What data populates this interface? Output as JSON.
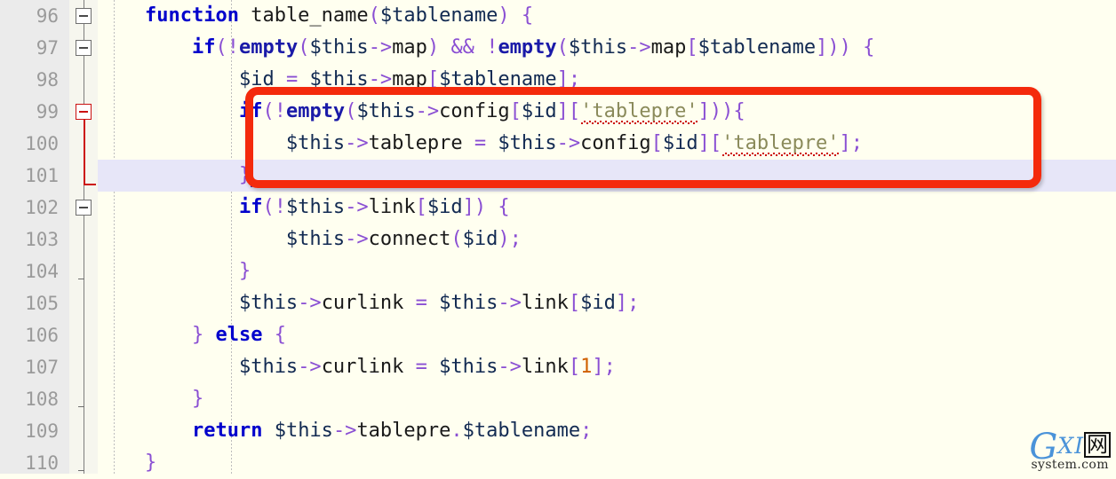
{
  "editor": {
    "background_color": "#fffff0",
    "gutter_color": "#ebebeb",
    "line_number_color": "#9a9a9a",
    "current_line_highlight_color": "#e7e6f8",
    "annotation_color": "#f42a0c",
    "first_line": 96,
    "last_line": 110,
    "current_line": 101
  },
  "line_numbers": [
    "96",
    "97",
    "98",
    "99",
    "100",
    "101",
    "102",
    "103",
    "104",
    "105",
    "106",
    "107",
    "108",
    "109",
    "110"
  ],
  "fold_markers": [
    {
      "line": "96",
      "type": "minus-box",
      "color": "#6e6e6e"
    },
    {
      "line": "97",
      "type": "minus-box",
      "color": "#6e6e6e"
    },
    {
      "line": "99",
      "type": "minus-box",
      "color": "#cc1111"
    },
    {
      "line": "101",
      "type": "fold-end",
      "color": "#cc1111"
    },
    {
      "line": "102",
      "type": "minus-box",
      "color": "#6e6e6e"
    },
    {
      "line": "104",
      "type": "tick",
      "color": "#6e6e6e"
    },
    {
      "line": "108",
      "type": "tick",
      "color": "#6e6e6e"
    },
    {
      "line": "110",
      "type": "tick",
      "color": "#6e6e6e"
    }
  ],
  "code_lines": [
    {
      "number": "96",
      "plain": "    function table_name($tablename) {",
      "tokens": [
        {
          "t": "    ",
          "c": "plain"
        },
        {
          "t": "function",
          "c": "kw"
        },
        {
          "t": " ",
          "c": "plain"
        },
        {
          "t": "table_name",
          "c": "plain"
        },
        {
          "t": "(",
          "c": "op"
        },
        {
          "t": "$tablename",
          "c": "var"
        },
        {
          "t": ")",
          "c": "op"
        },
        {
          "t": " ",
          "c": "plain"
        },
        {
          "t": "{",
          "c": "brc"
        }
      ]
    },
    {
      "number": "97",
      "plain": "        if(!empty($this->map) && !empty($this->map[$tablename])) {",
      "tokens": [
        {
          "t": "        ",
          "c": "plain"
        },
        {
          "t": "if",
          "c": "kw"
        },
        {
          "t": "(",
          "c": "op"
        },
        {
          "t": "!",
          "c": "op"
        },
        {
          "t": "empty",
          "c": "fn"
        },
        {
          "t": "(",
          "c": "op"
        },
        {
          "t": "$this",
          "c": "var"
        },
        {
          "t": "->",
          "c": "arrow"
        },
        {
          "t": "map",
          "c": "plain"
        },
        {
          "t": ")",
          "c": "op"
        },
        {
          "t": " ",
          "c": "plain"
        },
        {
          "t": "&&",
          "c": "op"
        },
        {
          "t": " ",
          "c": "plain"
        },
        {
          "t": "!",
          "c": "op"
        },
        {
          "t": "empty",
          "c": "fn"
        },
        {
          "t": "(",
          "c": "op"
        },
        {
          "t": "$this",
          "c": "var"
        },
        {
          "t": "->",
          "c": "arrow"
        },
        {
          "t": "map",
          "c": "plain"
        },
        {
          "t": "[",
          "c": "op"
        },
        {
          "t": "$tablename",
          "c": "var"
        },
        {
          "t": "]",
          "c": "op"
        },
        {
          "t": "))",
          "c": "op"
        },
        {
          "t": " ",
          "c": "plain"
        },
        {
          "t": "{",
          "c": "brc"
        }
      ]
    },
    {
      "number": "98",
      "plain": "            $id = $this->map[$tablename];",
      "tokens": [
        {
          "t": "            ",
          "c": "plain"
        },
        {
          "t": "$id",
          "c": "var"
        },
        {
          "t": " ",
          "c": "plain"
        },
        {
          "t": "=",
          "c": "op"
        },
        {
          "t": " ",
          "c": "plain"
        },
        {
          "t": "$this",
          "c": "var"
        },
        {
          "t": "->",
          "c": "arrow"
        },
        {
          "t": "map",
          "c": "plain"
        },
        {
          "t": "[",
          "c": "op"
        },
        {
          "t": "$tablename",
          "c": "var"
        },
        {
          "t": "]",
          "c": "op"
        },
        {
          "t": ";",
          "c": "op"
        }
      ]
    },
    {
      "number": "99",
      "plain": "            if(!empty($this->config[$id]['tablepre'])){",
      "tokens": [
        {
          "t": "            ",
          "c": "plain"
        },
        {
          "t": "if",
          "c": "kw"
        },
        {
          "t": "(",
          "c": "op"
        },
        {
          "t": "!",
          "c": "op"
        },
        {
          "t": "empty",
          "c": "fn"
        },
        {
          "t": "(",
          "c": "op"
        },
        {
          "t": "$this",
          "c": "var"
        },
        {
          "t": "->",
          "c": "arrow"
        },
        {
          "t": "config",
          "c": "plain"
        },
        {
          "t": "[",
          "c": "op"
        },
        {
          "t": "$id",
          "c": "var"
        },
        {
          "t": "]",
          "c": "op"
        },
        {
          "t": "[",
          "c": "op"
        },
        {
          "t": "'tablepre'",
          "c": "str squig"
        },
        {
          "t": "]",
          "c": "op"
        },
        {
          "t": "))",
          "c": "op"
        },
        {
          "t": "{",
          "c": "brc"
        }
      ]
    },
    {
      "number": "100",
      "plain": "                $this->tablepre = $this->config[$id]['tablepre'];",
      "tokens": [
        {
          "t": "                ",
          "c": "plain"
        },
        {
          "t": "$this",
          "c": "var"
        },
        {
          "t": "->",
          "c": "arrow"
        },
        {
          "t": "tablepre",
          "c": "plain"
        },
        {
          "t": " ",
          "c": "plain"
        },
        {
          "t": "=",
          "c": "op"
        },
        {
          "t": " ",
          "c": "plain"
        },
        {
          "t": "$this",
          "c": "var"
        },
        {
          "t": "->",
          "c": "arrow"
        },
        {
          "t": "config",
          "c": "plain"
        },
        {
          "t": "[",
          "c": "op"
        },
        {
          "t": "$id",
          "c": "var"
        },
        {
          "t": "]",
          "c": "op"
        },
        {
          "t": "[",
          "c": "op"
        },
        {
          "t": "'tablepre'",
          "c": "str squig"
        },
        {
          "t": "]",
          "c": "op"
        },
        {
          "t": ";",
          "c": "op"
        }
      ]
    },
    {
      "number": "101",
      "plain": "            }",
      "tokens": [
        {
          "t": "            ",
          "c": "plain"
        },
        {
          "t": "}",
          "c": "brc"
        }
      ]
    },
    {
      "number": "102",
      "plain": "            if(!$this->link[$id]) {",
      "tokens": [
        {
          "t": "            ",
          "c": "plain"
        },
        {
          "t": "if",
          "c": "kw"
        },
        {
          "t": "(",
          "c": "op"
        },
        {
          "t": "!",
          "c": "op"
        },
        {
          "t": "$this",
          "c": "var"
        },
        {
          "t": "->",
          "c": "arrow"
        },
        {
          "t": "link",
          "c": "plain"
        },
        {
          "t": "[",
          "c": "op"
        },
        {
          "t": "$id",
          "c": "var"
        },
        {
          "t": "]",
          "c": "op"
        },
        {
          "t": ")",
          "c": "op"
        },
        {
          "t": " ",
          "c": "plain"
        },
        {
          "t": "{",
          "c": "brc"
        }
      ]
    },
    {
      "number": "103",
      "plain": "                $this->connect($id);",
      "tokens": [
        {
          "t": "                ",
          "c": "plain"
        },
        {
          "t": "$this",
          "c": "var"
        },
        {
          "t": "->",
          "c": "arrow"
        },
        {
          "t": "connect",
          "c": "plain"
        },
        {
          "t": "(",
          "c": "op"
        },
        {
          "t": "$id",
          "c": "var"
        },
        {
          "t": ")",
          "c": "op"
        },
        {
          "t": ";",
          "c": "op"
        }
      ]
    },
    {
      "number": "104",
      "plain": "            }",
      "tokens": [
        {
          "t": "            ",
          "c": "plain"
        },
        {
          "t": "}",
          "c": "brc"
        }
      ]
    },
    {
      "number": "105",
      "plain": "            $this->curlink = $this->link[$id];",
      "tokens": [
        {
          "t": "            ",
          "c": "plain"
        },
        {
          "t": "$this",
          "c": "var"
        },
        {
          "t": "->",
          "c": "arrow"
        },
        {
          "t": "curlink",
          "c": "plain"
        },
        {
          "t": " ",
          "c": "plain"
        },
        {
          "t": "=",
          "c": "op"
        },
        {
          "t": " ",
          "c": "plain"
        },
        {
          "t": "$this",
          "c": "var"
        },
        {
          "t": "->",
          "c": "arrow"
        },
        {
          "t": "link",
          "c": "plain"
        },
        {
          "t": "[",
          "c": "op"
        },
        {
          "t": "$id",
          "c": "var"
        },
        {
          "t": "]",
          "c": "op"
        },
        {
          "t": ";",
          "c": "op"
        }
      ]
    },
    {
      "number": "106",
      "plain": "        } else {",
      "tokens": [
        {
          "t": "        ",
          "c": "plain"
        },
        {
          "t": "}",
          "c": "brc"
        },
        {
          "t": " ",
          "c": "plain"
        },
        {
          "t": "else",
          "c": "kw"
        },
        {
          "t": " ",
          "c": "plain"
        },
        {
          "t": "{",
          "c": "brc"
        }
      ]
    },
    {
      "number": "107",
      "plain": "            $this->curlink = $this->link[1];",
      "tokens": [
        {
          "t": "            ",
          "c": "plain"
        },
        {
          "t": "$this",
          "c": "var"
        },
        {
          "t": "->",
          "c": "arrow"
        },
        {
          "t": "curlink",
          "c": "plain"
        },
        {
          "t": " ",
          "c": "plain"
        },
        {
          "t": "=",
          "c": "op"
        },
        {
          "t": " ",
          "c": "plain"
        },
        {
          "t": "$this",
          "c": "var"
        },
        {
          "t": "->",
          "c": "arrow"
        },
        {
          "t": "link",
          "c": "plain"
        },
        {
          "t": "[",
          "c": "op"
        },
        {
          "t": "1",
          "c": "num"
        },
        {
          "t": "]",
          "c": "op"
        },
        {
          "t": ";",
          "c": "op"
        }
      ]
    },
    {
      "number": "108",
      "plain": "        }",
      "tokens": [
        {
          "t": "        ",
          "c": "plain"
        },
        {
          "t": "}",
          "c": "brc"
        }
      ]
    },
    {
      "number": "109",
      "plain": "        return $this->tablepre.$tablename;",
      "tokens": [
        {
          "t": "        ",
          "c": "plain"
        },
        {
          "t": "return",
          "c": "kw"
        },
        {
          "t": " ",
          "c": "plain"
        },
        {
          "t": "$this",
          "c": "var"
        },
        {
          "t": "->",
          "c": "arrow"
        },
        {
          "t": "tablepre",
          "c": "plain"
        },
        {
          "t": ".",
          "c": "op"
        },
        {
          "t": "$tablename",
          "c": "var"
        },
        {
          "t": ";",
          "c": "op"
        }
      ]
    },
    {
      "number": "110",
      "plain": "    }",
      "tokens": [
        {
          "t": "    ",
          "c": "plain"
        },
        {
          "t": "}",
          "c": "brc"
        }
      ]
    }
  ],
  "annotation": {
    "shape": "rounded-rectangle",
    "color": "#f42a0c",
    "covers_lines": [
      "99",
      "100",
      "101"
    ]
  },
  "watermark": {
    "letter_g": "G",
    "letters_xi": "XI",
    "cjk_box": "网",
    "domain": "system.com"
  }
}
